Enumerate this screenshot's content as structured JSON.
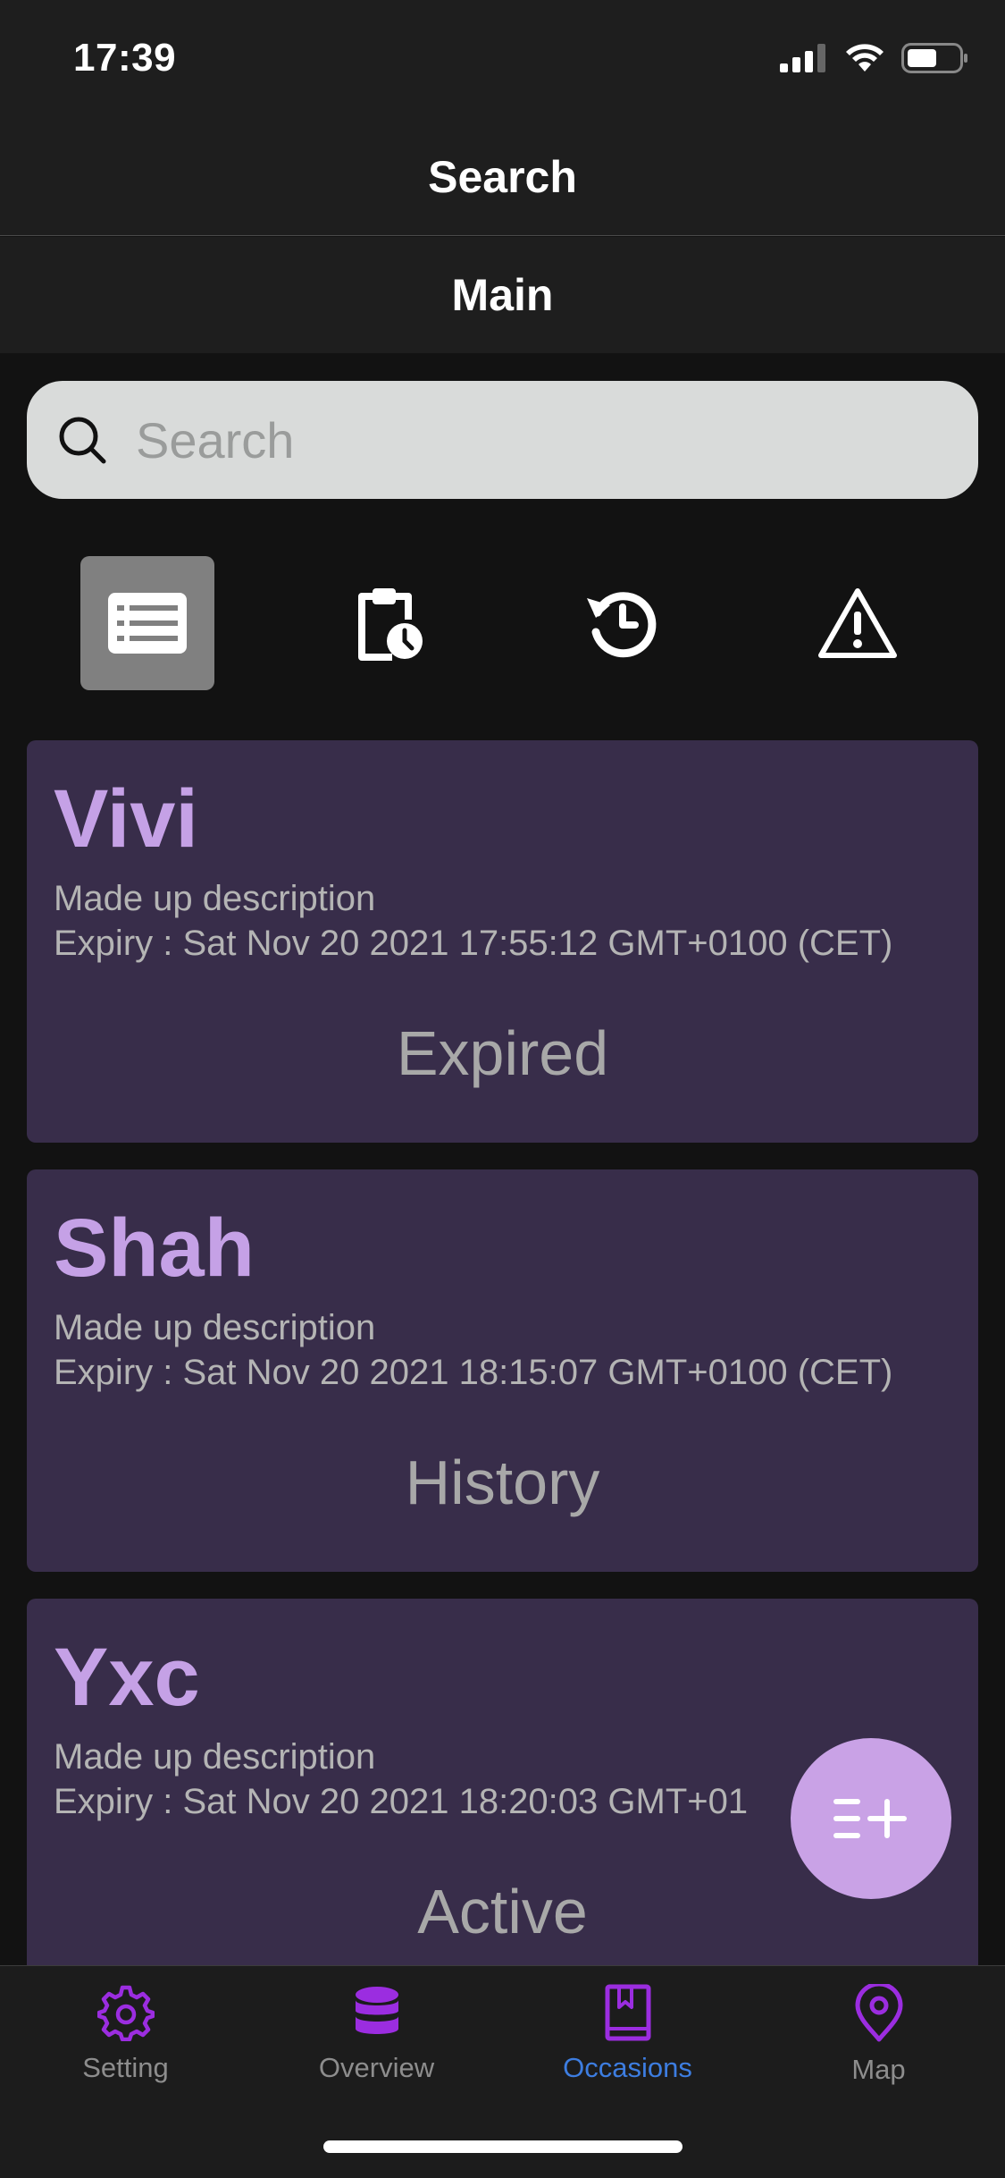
{
  "status_bar": {
    "time": "17:39"
  },
  "header": {
    "title": "Search"
  },
  "subheader": {
    "title": "Main"
  },
  "search": {
    "placeholder": "Search",
    "value": ""
  },
  "filters": [
    {
      "icon": "list-icon",
      "active": true
    },
    {
      "icon": "clipboard-clock-icon",
      "active": false
    },
    {
      "icon": "history-icon",
      "active": false
    },
    {
      "icon": "warning-icon",
      "active": false
    }
  ],
  "occasions": [
    {
      "title": "Vivi",
      "description": "Made up description",
      "expiry": "Expiry : Sat Nov 20 2021 17:55:12 GMT+0100 (CET)",
      "status": "Expired"
    },
    {
      "title": "Shah",
      "description": "Made up description",
      "expiry": "Expiry : Sat Nov 20 2021 18:15:07 GMT+0100 (CET)",
      "status": "History"
    },
    {
      "title": "Yxc",
      "description": "Made up description",
      "expiry": "Expiry : Sat Nov 20 2021 18:20:03 GMT+01",
      "status": "Active"
    }
  ],
  "fab": {
    "icon": "add-list-icon"
  },
  "tab_bar": {
    "tabs": [
      {
        "label": "Setting",
        "icon": "gear-icon"
      },
      {
        "label": "Overview",
        "icon": "database-icon"
      },
      {
        "label": "Occasions",
        "icon": "book-icon",
        "active": true
      },
      {
        "label": "Map",
        "icon": "map-pin-icon"
      }
    ]
  },
  "colors": {
    "background": "#121212",
    "bar": "#1e1e1e",
    "card": "#382d4a",
    "card_title": "#c5a1e6",
    "accent": "#9b2de0",
    "active_tab": "#3d7de0",
    "fab": "#c9a2e6"
  }
}
